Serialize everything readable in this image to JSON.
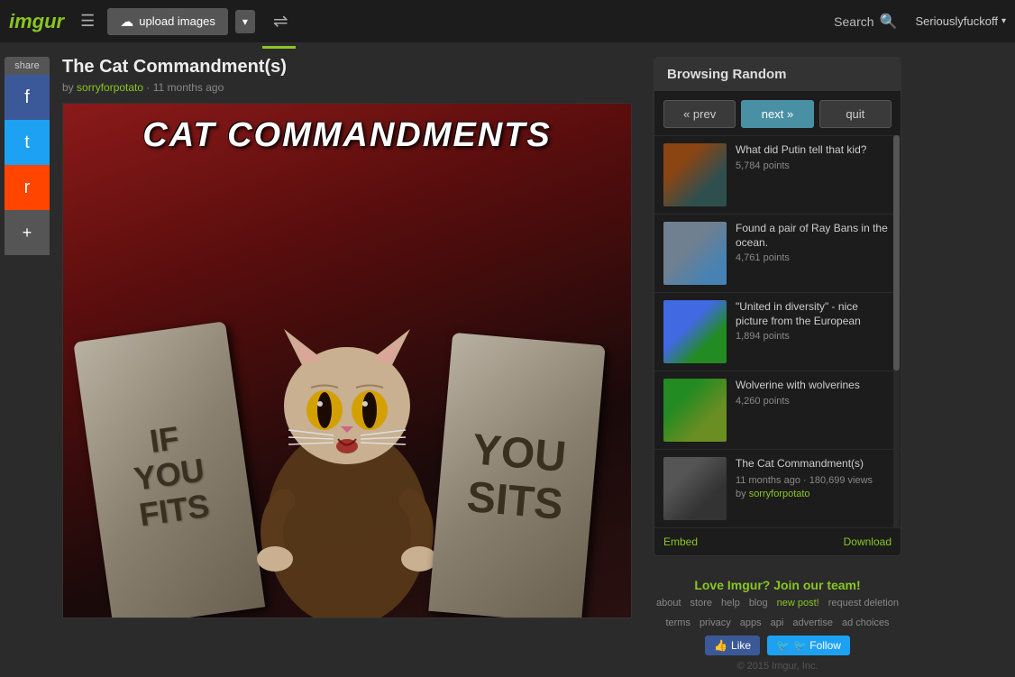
{
  "header": {
    "logo": "imgur",
    "hamburger_label": "☰",
    "upload_icon": "☁",
    "upload_label": "upload images",
    "dropdown_icon": "▾",
    "shuffle_icon": "⇌",
    "search_label": "Search",
    "search_icon": "🔍",
    "user_label": "Seriouslyfuckoff",
    "chevron": "▾"
  },
  "share": {
    "label": "share",
    "facebook_icon": "f",
    "twitter_icon": "t",
    "reddit_icon": "r",
    "more_icon": "+"
  },
  "post": {
    "title": "The Cat Commandment(s)",
    "meta_prefix": "by",
    "author": "sorryforpotato",
    "time": "11 months ago",
    "image_title": "CAT COMMANDMENTS",
    "tablet_left": "IF\nYOU\nFITS",
    "tablet_right": "YOU\nSITS"
  },
  "browsing": {
    "header": "Browsing Random",
    "prev_label": "« prev",
    "next_label": "next »",
    "quit_label": "quit",
    "items": [
      {
        "title": "What did Putin tell that kid?",
        "points": "5,784 points",
        "thumb_class": "related-thumb-1"
      },
      {
        "title": "Found a pair of Ray Bans in the ocean.",
        "points": "4,761 points",
        "thumb_class": "related-thumb-2"
      },
      {
        "title": "\"United in diversity\" - nice picture from the European",
        "points": "1,894 points",
        "thumb_class": "related-thumb-3"
      },
      {
        "title": "Wolverine with wolverines",
        "points": "4,260 points",
        "thumb_class": "related-thumb-4"
      },
      {
        "title": "The Cat Commandment(s)",
        "meta": "11 months ago · 180,699 views",
        "author": "sorryforpotato",
        "thumb_class": "related-thumb-5"
      }
    ],
    "embed_label": "Embed",
    "download_label": "Download"
  },
  "footer": {
    "love_text": "Love Imgur? Join our team!",
    "links": [
      {
        "label": "about",
        "href": "#"
      },
      {
        "label": "store",
        "href": "#"
      },
      {
        "label": "help",
        "href": "#"
      },
      {
        "label": "blog",
        "href": "#"
      },
      {
        "label": "new post!",
        "href": "#",
        "class": "new-post"
      },
      {
        "label": "request deletion",
        "href": "#"
      },
      {
        "label": "terms",
        "href": "#"
      },
      {
        "label": "privacy",
        "href": "#"
      },
      {
        "label": "apps",
        "href": "#"
      },
      {
        "label": "api",
        "href": "#"
      },
      {
        "label": "advertise",
        "href": "#"
      },
      {
        "label": "ad choices",
        "href": "#"
      }
    ],
    "fb_like": "👍 Like",
    "tw_follow": "🐦 Follow",
    "copyright": "© 2015 Imgur, Inc."
  }
}
